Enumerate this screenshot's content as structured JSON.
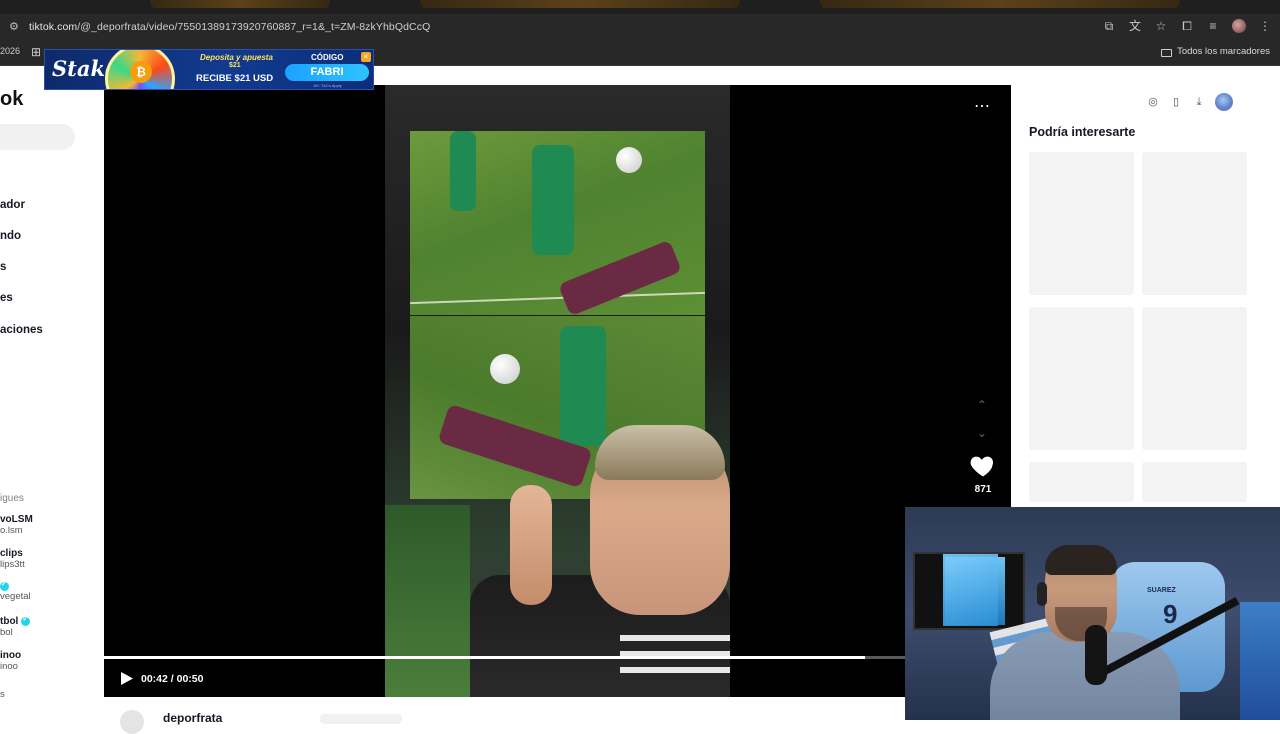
{
  "browser": {
    "url_domain": "tiktok.com",
    "url_path": "/@_deporfrata/video/7550138917392076088​7_r=1&_t=ZM-8zkYhbQdCcQ",
    "bookmark_year": "2026",
    "all_bookmarks_label": "Todos los marcadores"
  },
  "ad": {
    "brand": "Stake",
    "deposit_line": "Deposita y apuesta",
    "deposit_amount": "$21",
    "receive_line": "RECIBE $21 USD",
    "code_label": "CÓDIGO",
    "code_value": "FABRI",
    "fine_print": "18+ T&Cs Apply"
  },
  "sidebar": {
    "logo_fragment": "ok",
    "nav_items": [
      "ador",
      "ndo",
      "s",
      "es",
      "aciones"
    ],
    "following_title": "igues",
    "accounts": [
      {
        "name": "voLSM",
        "handle": "o.lsm",
        "verified": false
      },
      {
        "name": "clips",
        "handle": "lips3tt",
        "verified": false
      },
      {
        "name": "",
        "handle": "vegetal",
        "verified": true
      },
      {
        "name": "tbol",
        "handle": "bol",
        "verified": true
      },
      {
        "name": "inoo",
        "handle": "inoo",
        "verified": false
      },
      {
        "name": "",
        "handle": "s",
        "verified": false
      }
    ]
  },
  "video": {
    "like_count": "871",
    "time_display": "00:42 / 00:50",
    "progress": 0.95,
    "author": "deporfrata"
  },
  "recommend": {
    "title": "Podría interesarte"
  },
  "webcam": {
    "jersey_number": "9",
    "jersey_name": "SUAREZ"
  }
}
